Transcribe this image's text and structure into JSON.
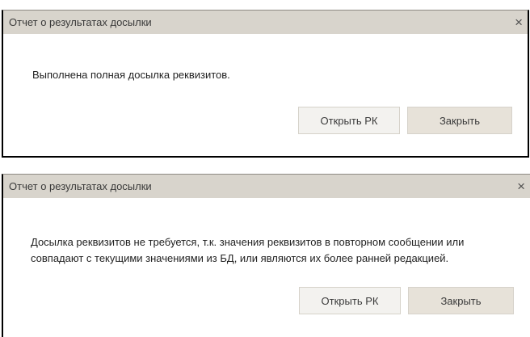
{
  "dialogs": [
    {
      "title": "Отчет о результатах досылки",
      "close_glyph": "×",
      "message": "Выполнена полная досылка реквизитов.",
      "open_button": "Открыть РК",
      "close_button": "Закрыть"
    },
    {
      "title": "Отчет о результатах досылки",
      "close_glyph": "×",
      "message_line1": "Досылка реквизитов не требуется, т.к. значения реквизитов в повторном сообщении или",
      "message_line2": "совпадают с текущими значениями из БД, или являются их более ранней редакцией.",
      "open_button": "Открыть РК",
      "close_button": "Закрыть"
    }
  ],
  "colors": {
    "titlebar_bg": "#d8d4cc",
    "button_open_bg": "#f3f2ef",
    "button_close_bg": "#e7e2d9"
  }
}
